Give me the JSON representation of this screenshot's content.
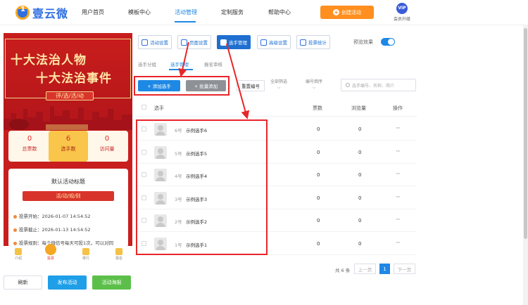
{
  "brand": {
    "logo_text": "壹云微",
    "logo_glyph": "1"
  },
  "nav": {
    "items": [
      "用户首页",
      "模板中心",
      "活动管理",
      "定制服务",
      "帮助中心"
    ],
    "active": "活动管理",
    "create_label": "创建活动",
    "vip_badge": "VIP",
    "vip_label": "会员升级"
  },
  "preview": {
    "banner_line1": "十大法治人物",
    "banner_line2": "十大法治事件",
    "banner_pill": "评/选/活/动",
    "stats": [
      {
        "num": "0",
        "label": "总票数"
      },
      {
        "num": "6",
        "label": "选手数"
      },
      {
        "num": "0",
        "label": "访问量"
      }
    ],
    "info_title": "默认活动标题",
    "info_pill": "活/动/规/则",
    "lines": [
      "投票开始：2026-01-07 14:54:52",
      "投票截止：2026-01-13 14:54:52",
      "投票规则：每个微信号每天可投1次，可以对同"
    ],
    "tabs": [
      "介绍",
      "投票",
      "排行",
      "报名"
    ]
  },
  "bottom_buttons": {
    "refresh": "刷新",
    "publish": "发布活动",
    "poster": "活动海报"
  },
  "toolbar": {
    "items": [
      "活动设置",
      "页面设置",
      "选手管理",
      "高级设置",
      "投票统计"
    ],
    "active": "选手管理",
    "preview_label": "预览效果"
  },
  "subtabs": {
    "items": [
      "选手分组",
      "选手管理",
      "报名审核"
    ],
    "active": "选手管理"
  },
  "filters": {
    "add": "+ 添加选手",
    "batch": "+ 批量添加",
    "reset_number": "重置编号",
    "all_filter": "全部筛选",
    "number_order": "编号倒序",
    "search_placeholder": "选手编号、名称、简介"
  },
  "table": {
    "headers": {
      "player": "选手",
      "votes": "票数",
      "views": "浏览量",
      "actions": "操作"
    },
    "rows": [
      {
        "number": "6号",
        "name": "示例选手6",
        "votes": "0",
        "views": "0",
        "more": "···"
      },
      {
        "number": "5号",
        "name": "示例选手5",
        "votes": "0",
        "views": "0",
        "more": "···"
      },
      {
        "number": "4号",
        "name": "示例选手4",
        "votes": "0",
        "views": "0",
        "more": "···"
      },
      {
        "number": "3号",
        "name": "示例选手3",
        "votes": "0",
        "views": "0",
        "more": "···"
      },
      {
        "number": "2号",
        "name": "示例选手2",
        "votes": "0",
        "views": "0",
        "more": "···"
      },
      {
        "number": "1号",
        "name": "示例选手1",
        "votes": "0",
        "views": "0",
        "more": "···"
      }
    ]
  },
  "pagination": {
    "total": "共 6 条",
    "prev": "上一页",
    "current": "1",
    "next": "下一页"
  },
  "colors": {
    "accent": "#1e88e5",
    "orange": "#ff8f1f",
    "annotation": "#e8262a",
    "poster_red": "#c81e1e"
  },
  "icons": [
    "logo-icon",
    "plus-icon",
    "vip-icon",
    "gear-icon",
    "page-icon",
    "users-icon",
    "sliders-icon",
    "bar-chart-icon",
    "search-icon",
    "avatar-icon",
    "more-icon"
  ]
}
